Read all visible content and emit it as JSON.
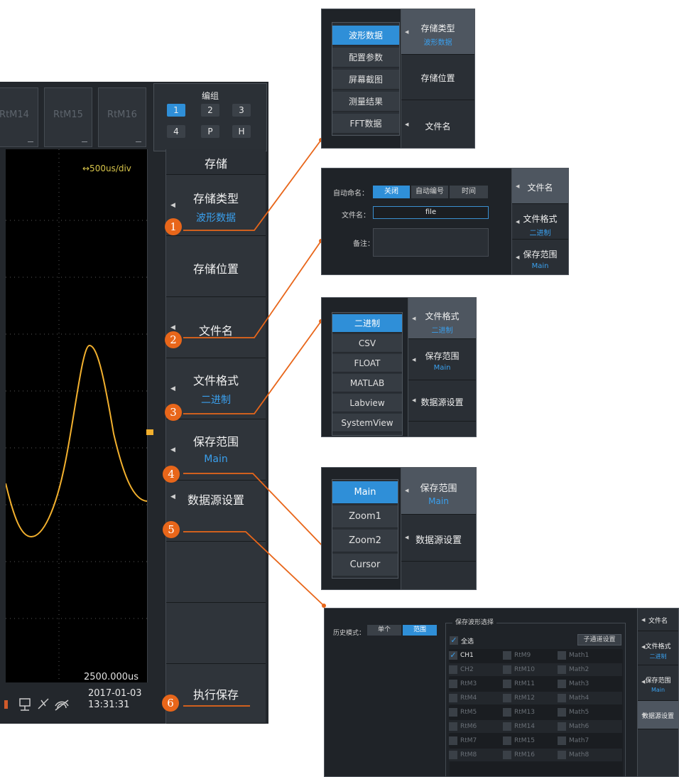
{
  "scope": {
    "channel_tabs": [
      "RtM14",
      "RtM15",
      "RtM16"
    ],
    "group": {
      "title": "编组",
      "buttons": [
        "1",
        "2",
        "3",
        "4",
        "P",
        "H"
      ],
      "selected": "1"
    },
    "timebase": "↔500us/div",
    "time_start": "2500.000us",
    "datetime": {
      "date": "2017-01-03",
      "time": "13:31:31"
    },
    "menu": {
      "title": "存储",
      "items": [
        {
          "label": "存储类型",
          "value": "波形数据"
        },
        {
          "label": "存储位置",
          "value": ""
        },
        {
          "label": "文件名",
          "value": ""
        },
        {
          "label": "文件格式",
          "value": "二进制"
        },
        {
          "label": "保存范围",
          "value": "Main"
        },
        {
          "label": "数据源设置",
          "value": ""
        },
        {
          "label": "执行保存",
          "value": ""
        }
      ]
    }
  },
  "callouts": [
    "1",
    "2",
    "3",
    "4",
    "5",
    "6"
  ],
  "panel1": {
    "options": [
      "波形数据",
      "配置参数",
      "屏幕截图",
      "测量结果",
      "FFT数据"
    ],
    "selected": "波形数据",
    "side": [
      {
        "label": "存储类型",
        "value": "波形数据"
      },
      {
        "label": "存储位置",
        "value": ""
      },
      {
        "label": "文件名",
        "value": ""
      }
    ]
  },
  "panel2": {
    "auto_name_label": "自动命名：",
    "auto_name_options": [
      "关闭",
      "自动编号",
      "时间"
    ],
    "auto_name_selected": "关闭",
    "filename_label": "文件名：",
    "filename_value": "file",
    "note_label": "备注：",
    "side": [
      {
        "label": "文件名",
        "value": ""
      },
      {
        "label": "文件格式",
        "value": "二进制"
      },
      {
        "label": "保存范围",
        "value": "Main"
      }
    ]
  },
  "panel3": {
    "options": [
      "二进制",
      "CSV",
      "FLOAT",
      "MATLAB",
      "Labview",
      "SystemView"
    ],
    "selected": "二进制",
    "side": [
      {
        "label": "文件格式",
        "value": "二进制"
      },
      {
        "label": "保存范围",
        "value": "Main"
      },
      {
        "label": "数据源设置",
        "value": ""
      }
    ]
  },
  "panel4": {
    "options": [
      "Main",
      "Zoom1",
      "Zoom2",
      "Cursor"
    ],
    "selected": "Main",
    "side": [
      {
        "label": "保存范围",
        "value": "Main"
      },
      {
        "label": "数据源设置",
        "value": ""
      }
    ]
  },
  "panel5": {
    "history_label": "历史模式：",
    "history_options": [
      "单个",
      "范围"
    ],
    "history_selected": "范围",
    "group_title": "保存波形选择",
    "select_all": "全选",
    "subchannel_button": "子通道设置",
    "rows": [
      [
        "CH1",
        "RtM9",
        "Math1"
      ],
      [
        "CH2",
        "RtM10",
        "Math2"
      ],
      [
        "RtM3",
        "RtM11",
        "Math3"
      ],
      [
        "RtM4",
        "RtM12",
        "Math4"
      ],
      [
        "RtM5",
        "RtM13",
        "Math5"
      ],
      [
        "RtM6",
        "RtM14",
        "Math6"
      ],
      [
        "RtM7",
        "RtM15",
        "Math7"
      ],
      [
        "RtM8",
        "RtM16",
        "Math8"
      ]
    ],
    "checked": [
      "CH1"
    ],
    "side": [
      {
        "label": "文件名",
        "value": ""
      },
      {
        "label": "文件格式",
        "value": "二进制"
      },
      {
        "label": "保存范围",
        "value": "Main"
      },
      {
        "label": "数据源设置",
        "value": ""
      }
    ]
  },
  "colors": {
    "accent_blue": "#2f8fd8",
    "value_blue": "#3aa0ee",
    "callout_orange": "#e8661a",
    "waveform": "#f2b02e",
    "timebase_text": "#d7c44a"
  }
}
